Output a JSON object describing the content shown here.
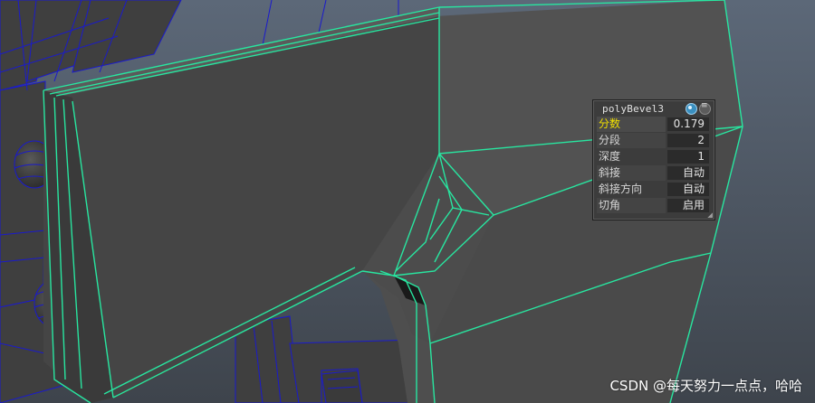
{
  "hud": {
    "title": "polyBevel3",
    "rows": [
      {
        "label": "分数",
        "value": "0.179"
      },
      {
        "label": "分段",
        "value": "2"
      },
      {
        "label": "深度",
        "value": "1"
      },
      {
        "label": "斜接",
        "value": "自动"
      },
      {
        "label": "斜接方向",
        "value": "自动"
      },
      {
        "label": "切角",
        "value": "启用"
      }
    ],
    "active_row_color": "#f0e000"
  },
  "watermark": "CSDN @每天努力一点点，哈哈",
  "colors": {
    "viewport_bg": "#4a4d52",
    "mesh_face": "#4b4b4b",
    "selected_edge": "#28e6a0",
    "wireframe": "#1a1acc"
  },
  "icons": {
    "hud_toggle": "channel-toggle-icon",
    "hud_menu": "hud-menu-icon",
    "resize": "resize-grip-icon"
  }
}
